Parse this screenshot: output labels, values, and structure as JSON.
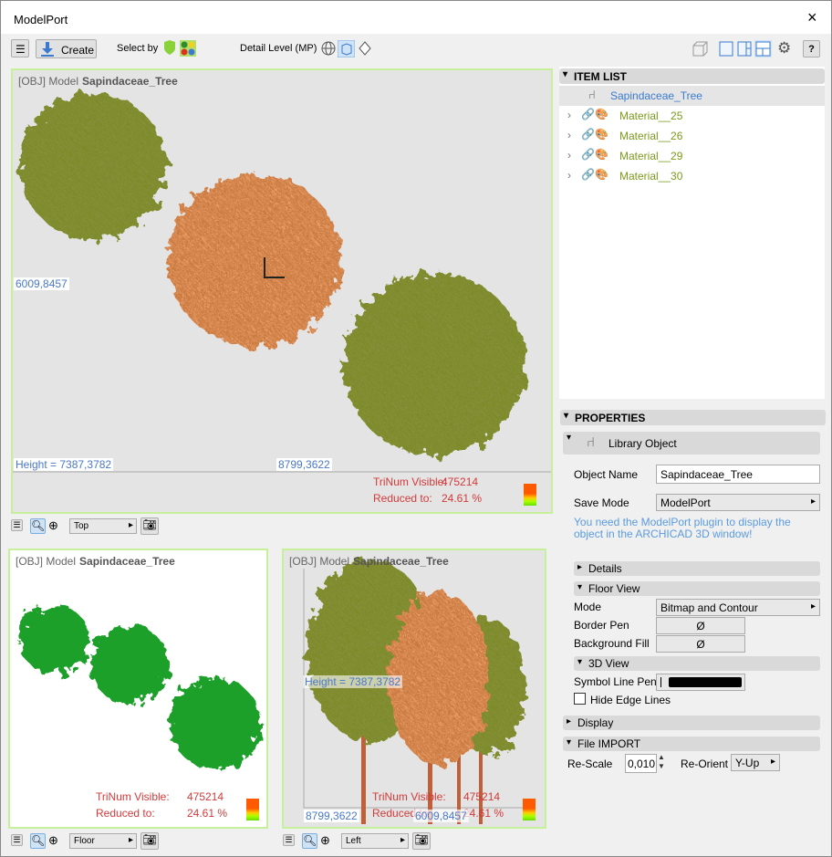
{
  "window": {
    "title": "ModelPort",
    "close": "×"
  },
  "toolbar": {
    "create_label": "Create",
    "select_by_label": "Select by",
    "detail_level_label": "Detail Level (MP)",
    "help_label": "?"
  },
  "viewports": [
    {
      "prefix": "[OBJ] Model",
      "name": "Sapindaceae_Tree",
      "view": "Top",
      "coord_left": "6009,8457",
      "height_label": "Height = 7387,3782",
      "coord_bottom": "8799,3622",
      "trinum_label": "TriNum Visible:",
      "trinum_value": "475214",
      "reduced_label": "Reduced to:",
      "reduced_value": "24.61 %"
    },
    {
      "prefix": "[OBJ] Model",
      "name": "Sapindaceae_Tree",
      "view": "Floor",
      "trinum_label": "TriNum Visible:",
      "trinum_value": "475214",
      "reduced_label": "Reduced to:",
      "reduced_value": "24.61 %"
    },
    {
      "prefix": "[OBJ] Model",
      "name": "Sapindaceae_Tree",
      "view": "Left",
      "height_label": "Height = 7387,3782",
      "coord_left": "8799,3622",
      "coord_bottom": "6009,8457",
      "trinum_label": "TriNum Visible:",
      "trinum_value": "475214",
      "reduced_label": "Reduced to:",
      "reduced_value": "24.61 %"
    }
  ],
  "item_list": {
    "title": "ITEM LIST",
    "root": "Sapindaceae_Tree",
    "items": [
      "Material__25",
      "Material__26",
      "Material__29",
      "Material__30"
    ]
  },
  "properties": {
    "title": "PROPERTIES",
    "object_type": "Library Object",
    "object_name_label": "Object Name",
    "object_name_value": "Sapindaceae_Tree",
    "save_mode_label": "Save Mode",
    "save_mode_value": "ModelPort",
    "notice": "You need the ModelPort plugin to display the object in the ARCHICAD 3D window!",
    "details": "Details",
    "floor_view": "Floor View",
    "mode_label": "Mode",
    "mode_value": "Bitmap and Contour",
    "border_pen_label": "Border Pen",
    "background_fill_label": "Background Fill",
    "empty_symbol": "Ø",
    "view3d": "3D View",
    "symbol_line_pen_label": "Symbol Line Pen",
    "hide_edge_lines": "Hide Edge Lines",
    "hide_edge_lines_checked": false,
    "display": "Display",
    "file_import": "File IMPORT",
    "rescale_label": "Re-Scale",
    "rescale_value": "0,010",
    "reorient_label": "Re-Orient",
    "reorient_value": "Y-Up"
  },
  "colors": {
    "accent": "#4a78c8",
    "stat_red": "#d23a3a",
    "viewport_border": "#c6f09a",
    "material_text": "#7a9a1c"
  }
}
